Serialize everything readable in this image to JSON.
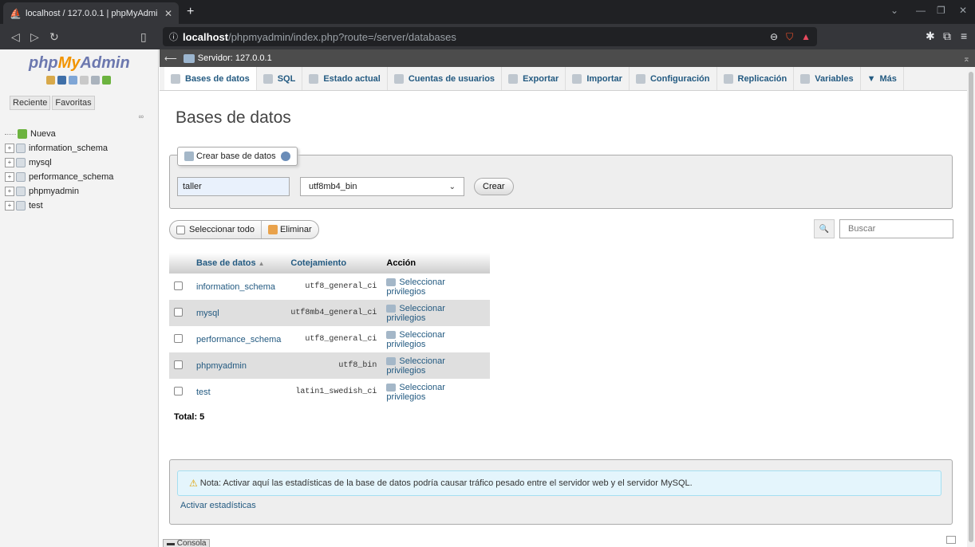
{
  "browser": {
    "tab_title": "localhost / 127.0.0.1 | phpMyAdmi",
    "url_host": "localhost",
    "url_path": "/phpmyadmin/index.php?route=/server/databases"
  },
  "sidebar": {
    "logo_php": "php",
    "logo_my": "My",
    "logo_admin": "Admin",
    "tabs": [
      "Reciente",
      "Favoritas"
    ],
    "tree": [
      "Nueva",
      "information_schema",
      "mysql",
      "performance_schema",
      "phpmyadmin",
      "test"
    ]
  },
  "server_bar": {
    "label": "Servidor: 127.0.0.1"
  },
  "menu": [
    "Bases de datos",
    "SQL",
    "Estado actual",
    "Cuentas de usuarios",
    "Exportar",
    "Importar",
    "Configuración",
    "Replicación",
    "Variables",
    "Más"
  ],
  "main": {
    "title": "Bases de datos",
    "create": {
      "legend": "Crear base de datos",
      "dbname_value": "taller",
      "collation_value": "utf8mb4_bin",
      "create_button": "Crear"
    },
    "select_all": "Seleccionar todo",
    "delete": "Eliminar",
    "search_placeholder": "Buscar",
    "table": {
      "headers": [
        "Base de datos",
        "Cotejamiento",
        "Acción"
      ],
      "rows": [
        {
          "name": "information_schema",
          "collation": "utf8_general_ci",
          "action": "Seleccionar privilegios"
        },
        {
          "name": "mysql",
          "collation": "utf8mb4_general_ci",
          "action": "Seleccionar privilegios"
        },
        {
          "name": "performance_schema",
          "collation": "utf8_general_ci",
          "action": "Seleccionar privilegios"
        },
        {
          "name": "phpmyadmin",
          "collation": "utf8_bin",
          "action": "Seleccionar privilegios"
        },
        {
          "name": "test",
          "collation": "latin1_swedish_ci",
          "action": "Seleccionar privilegios"
        }
      ],
      "total": "Total: 5"
    },
    "notice": "Nota: Activar aquí las estadísticas de la base de datos podría causar tráfico pesado entre el servidor web y el servidor MySQL.",
    "enable_stats": "Activar estadísticas"
  },
  "console": {
    "label": "Consola"
  }
}
